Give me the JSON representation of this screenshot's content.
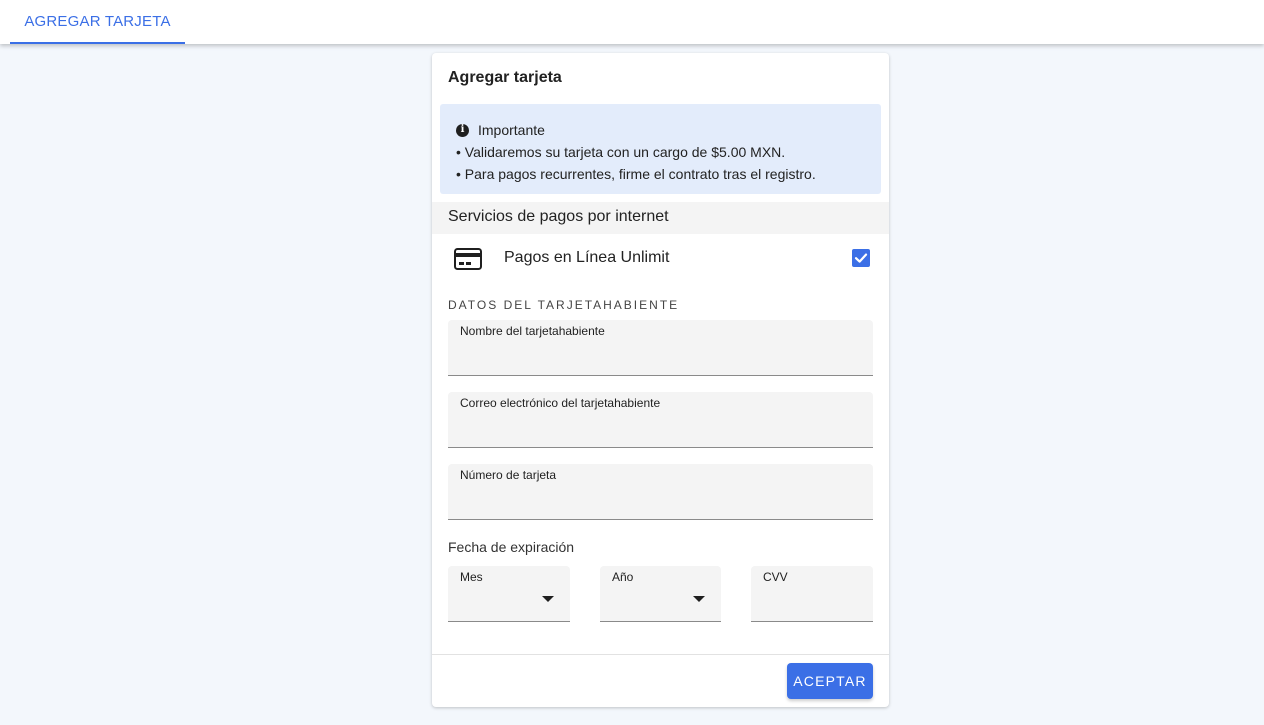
{
  "header": {
    "tab_label": "AGREGAR TARJETA"
  },
  "card": {
    "title": "Agregar tarjeta",
    "notice": {
      "icon": "info-icon",
      "title": "Importante",
      "lines": [
        "• Validaremos su tarjeta con un cargo de $5.00 MXN.",
        "• Para pagos recurrentes, firme el contrato tras el registro."
      ]
    },
    "section_title": "Servicios de pagos por internet",
    "service": {
      "icon": "credit-card-icon",
      "label": "Pagos en Línea Unlimit",
      "checked": true
    },
    "cardholder_heading": "DATOS DEL TARJETAHABIENTE",
    "fields": {
      "name": {
        "label": "Nombre del tarjetahabiente",
        "value": ""
      },
      "email": {
        "label": "Correo electrónico del tarjetahabiente",
        "value": ""
      },
      "number": {
        "label": "Número de tarjeta",
        "value": ""
      }
    },
    "expiration": {
      "label": "Fecha de expiración",
      "month": {
        "label": "Mes",
        "value": ""
      },
      "year": {
        "label": "Año",
        "value": ""
      },
      "cvv": {
        "label": "CVV",
        "value": ""
      }
    },
    "accept_label": "ACEPTAR"
  },
  "colors": {
    "accent": "#3b6fe6",
    "notice_bg": "#e3ecfb",
    "page_bg": "#f3f7fc"
  }
}
